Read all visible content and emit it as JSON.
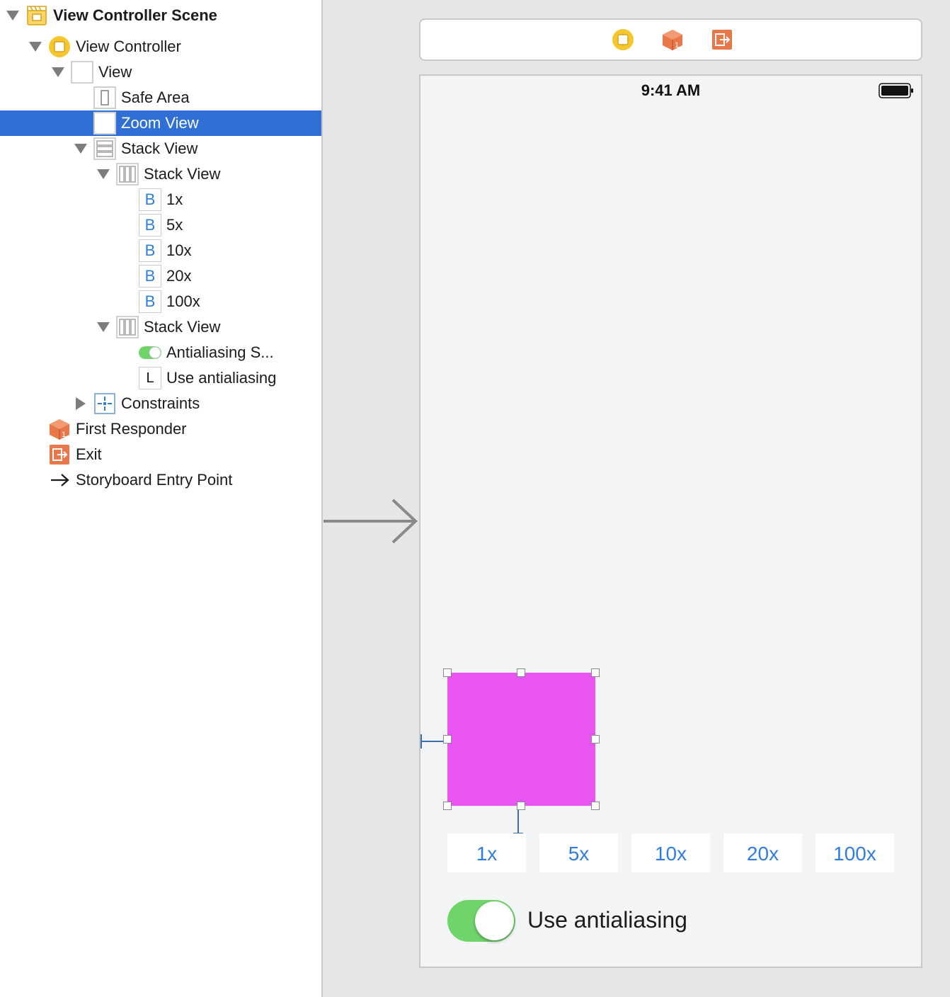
{
  "outline": {
    "items": [
      {
        "label": "View Controller Scene",
        "icon": "storyboard-scene-icon"
      },
      {
        "label": "View Controller",
        "icon": "view-controller-icon"
      },
      {
        "label": "View",
        "icon": "view-icon"
      },
      {
        "label": "Safe Area",
        "icon": "safe-area-icon"
      },
      {
        "label": "Zoom View",
        "icon": "view-icon",
        "selected": true
      },
      {
        "label": "Stack View",
        "icon": "vertical-stack-icon"
      },
      {
        "label": "Stack View",
        "icon": "horizontal-stack-icon"
      },
      {
        "label": "1x",
        "icon": "button-icon",
        "glyph": "B"
      },
      {
        "label": "5x",
        "icon": "button-icon",
        "glyph": "B"
      },
      {
        "label": "10x",
        "icon": "button-icon",
        "glyph": "B"
      },
      {
        "label": "20x",
        "icon": "button-icon",
        "glyph": "B"
      },
      {
        "label": "100x",
        "icon": "button-icon",
        "glyph": "B"
      },
      {
        "label": "Stack View",
        "icon": "horizontal-stack-icon"
      },
      {
        "label": "Antialiasing S...",
        "icon": "switch-icon"
      },
      {
        "label": "Use antialiasing",
        "icon": "label-icon",
        "glyph": "L"
      },
      {
        "label": "Constraints",
        "icon": "constraints-icon"
      },
      {
        "label": "First Responder",
        "icon": "first-responder-icon"
      },
      {
        "label": "Exit",
        "icon": "exit-icon"
      },
      {
        "label": "Storyboard Entry Point",
        "icon": "arrow-right-icon"
      }
    ]
  },
  "scene_dock": {
    "icons": [
      "view-controller-icon",
      "first-responder-icon",
      "exit-icon"
    ]
  },
  "device": {
    "status_time": "9:41 AM",
    "zoom_view_color": "#e955f2",
    "buttons": [
      "1x",
      "5x",
      "10x",
      "20x",
      "100x"
    ],
    "toggle_label": "Use antialiasing",
    "toggle_on": true
  },
  "colors": {
    "selection": "#2f6fd6",
    "accent": "#2f7de1",
    "switch_on": "#6fd56a",
    "object_orange": "#e8774a",
    "vc_yellow": "#f6c62f"
  }
}
